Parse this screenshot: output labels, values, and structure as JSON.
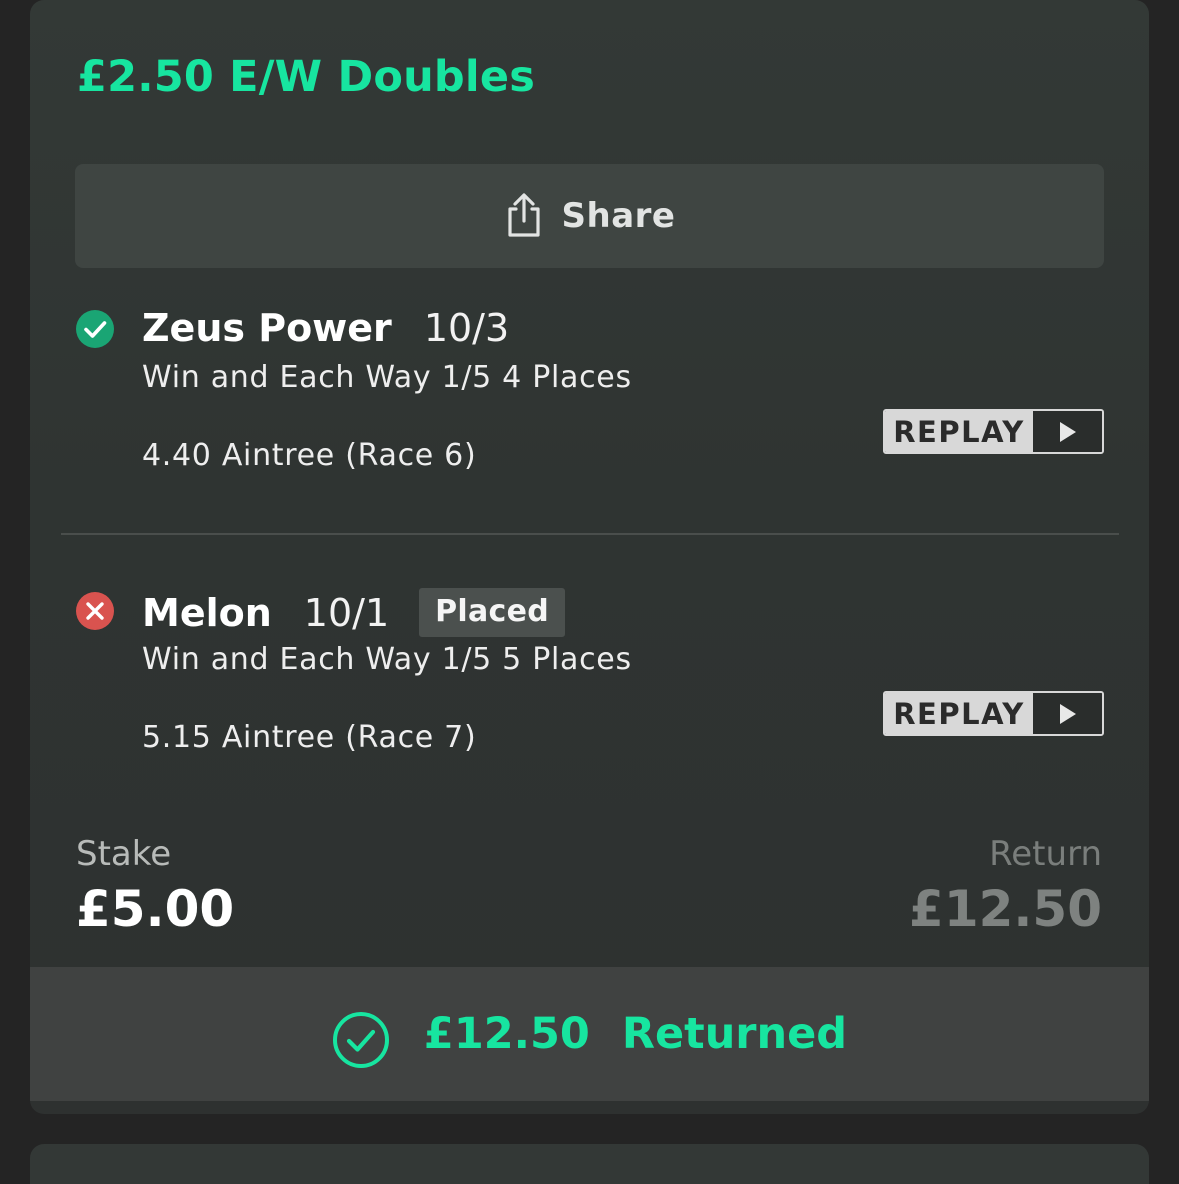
{
  "bet": {
    "title": "£2.50 E/W Doubles",
    "share_label": "Share",
    "selections": [
      {
        "status": "won",
        "runner": "Zeus Power",
        "odds": "10/3",
        "badge": "",
        "market": "Win and Each Way 1/5 4 Places",
        "event": "4.40 Aintree (Race 6)",
        "replay_label": "REPLAY"
      },
      {
        "status": "lost",
        "runner": "Melon",
        "odds": "10/1",
        "badge": "Placed",
        "market": "Win and Each Way 1/5 5 Places",
        "event": "5.15 Aintree (Race 7)",
        "replay_label": "REPLAY"
      }
    ],
    "stake_label": "Stake",
    "stake_value": "£5.00",
    "return_label": "Return",
    "return_value": "£12.50",
    "footer_amount": "£12.50",
    "footer_status": "Returned"
  },
  "colors": {
    "accent": "#17e5a0",
    "won": "#1aa574",
    "lost": "#d9534f"
  },
  "icons": {
    "share": "share-icon",
    "won": "check-circle-icon",
    "lost": "x-circle-icon",
    "play": "play-icon",
    "returned": "check-circle-outline-icon"
  }
}
